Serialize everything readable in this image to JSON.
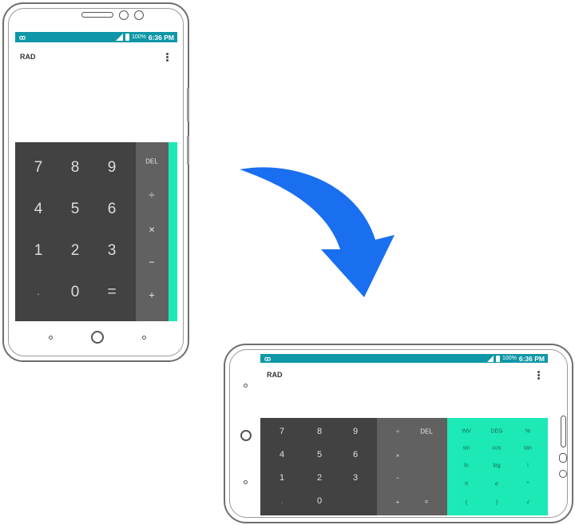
{
  "portrait": {
    "status_bar": {
      "left_icon": "voicemail-icon",
      "battery": "100%",
      "time": "6:36 PM"
    },
    "mode": "RAD",
    "digits": [
      "7",
      "8",
      "9",
      "4",
      "5",
      "6",
      "1",
      "2",
      "3",
      ".",
      "0",
      "="
    ],
    "operators": [
      "DEL",
      "÷",
      "×",
      "−",
      "+"
    ]
  },
  "landscape": {
    "status_bar": {
      "left_icon": "voicemail-icon",
      "battery": "100%",
      "time": "6:36 PM"
    },
    "mode": "RAD",
    "digits": [
      "7",
      "8",
      "9",
      "4",
      "5",
      "6",
      "1",
      "2",
      "3",
      ".",
      "0"
    ],
    "operators": [
      "÷",
      "DEL",
      "×",
      "−",
      "+",
      "="
    ],
    "advanced": [
      "INV",
      "DEG",
      "%",
      "sin",
      "cos",
      "tan",
      "ln",
      "log",
      "!",
      "π",
      "e",
      "^",
      "(",
      ")",
      "√"
    ]
  },
  "colors": {
    "status_bar": "#0f97a7",
    "pad": "#424242",
    "ops": "#616161",
    "advanced": "#1de9b6",
    "arrow": "#1a6ff0"
  }
}
